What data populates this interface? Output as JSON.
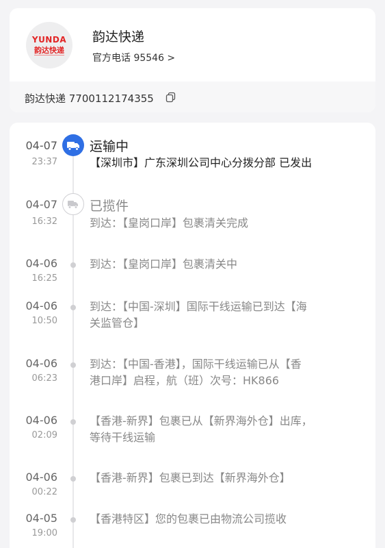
{
  "courier": {
    "logo_text_en": "YUNDA",
    "logo_text_cn": "韵达快递",
    "name": "韵达快递",
    "phone": "官方电话 95546 >",
    "tracking": "韵达快递 7700112174355"
  },
  "events": [
    {
      "date": "04-07",
      "time": "23:37",
      "status": "运输中",
      "icon": "truck-icon",
      "desc": "【深圳市】广东深圳公司中心分拨分部 已发出"
    },
    {
      "date": "04-07",
      "time": "16:32",
      "status": "已揽件",
      "icon": "pickup-truck-icon",
      "desc": "到达：【皇岗口岸】包裹清关完成"
    },
    {
      "date": "04-06",
      "time": "16:25",
      "desc": "到达：【皇岗口岸】包裹清关中"
    },
    {
      "date": "04-06",
      "time": "10:50",
      "desc_lines": [
        "到达：【中国-深圳】国际干线运输已到达【海",
        "关监管仓】"
      ]
    },
    {
      "date": "04-06",
      "time": "06:23",
      "desc_lines": [
        "到达：【中国-香港】，国际干线运输已从【香",
        "港口岸】启程，航（班）次号：HK866"
      ]
    },
    {
      "date": "04-06",
      "time": "02:09",
      "desc_lines": [
        "【香港-新界】包裹已从【新界海外仓】出库，",
        "等待干线运输"
      ]
    },
    {
      "date": "04-06",
      "time": "00:22",
      "desc": "【香港-新界】包裹已到达【新界海外仓】"
    },
    {
      "date": "04-05",
      "time": "19:00",
      "desc": "【香港特区】您的包裹已由物流公司揽收"
    }
  ]
}
